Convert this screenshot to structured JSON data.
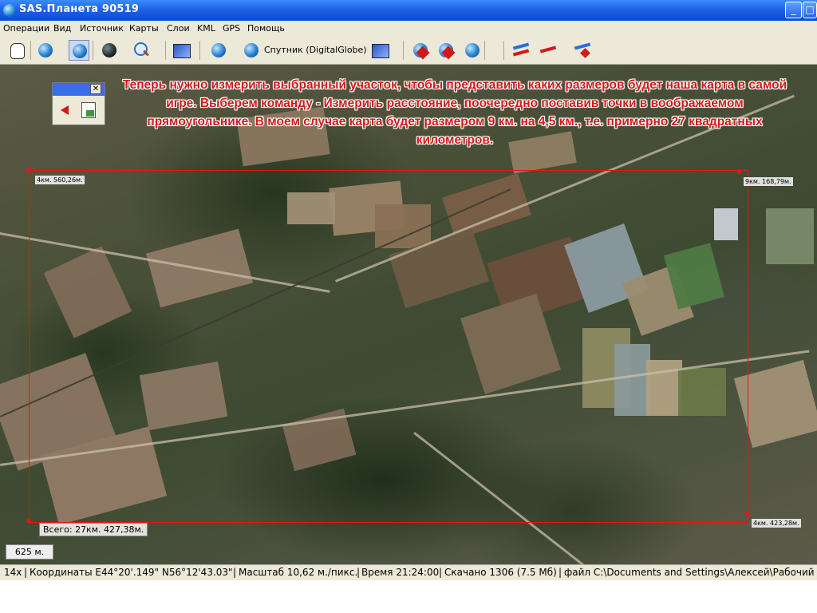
{
  "window": {
    "title": "SAS.Планета 90519",
    "minimize_glyph": "_",
    "maximize_glyph": "□"
  },
  "menu": [
    "Операции",
    "Вид",
    "Источник",
    "Карты",
    "Слои",
    "KML",
    "GPS",
    "Помощь"
  ],
  "toolbar": {
    "source_label": "Спутник (DigitalGlobe)",
    "icons": [
      "hand-icon",
      "settings-globe-icon",
      "globe-active-icon",
      "dark-globe-icon",
      "zoom-icon",
      "map-image-icon",
      "globe-blue-icon",
      "satellite-source-icon",
      "layers-icon",
      "marker-icon",
      "delete-marker-icon",
      "refresh-icon",
      "line-measure-icon",
      "polygon-icon",
      "delete-path-icon"
    ]
  },
  "mini_panel": {
    "close_glyph": "✕"
  },
  "overlay_text": "Теперь нужно измерить выбранный участок, чтобы представить каких размеров будет наша карта в самой игре. Выберем команду - Измерить расстояние, поочередно поставив точки в воображаемом прямоугольнике. В моем случае карта будет размером 9 км. на 4,5 км., т.е. примерно 27 квадратных километров.",
  "measure": {
    "top_left": "4км. 560,26м.",
    "top_right": "9км. 168,79м.",
    "bottom_right": "4км. 423,28м.",
    "total": "Всего: 27км. 427,38м."
  },
  "scale": "625 м.",
  "status": {
    "zoom": "14x",
    "coordinates": "Координаты E44°20'.149\" N56°12'43.03\"",
    "scale": "Масштаб 10,62 м./пикс.",
    "time": "Время 21:24:00",
    "downloaded": "Скачано 1306 (7.5 Мб)",
    "file": "файл C:\\Documents and Settings\\Алексей\\Рабочий"
  }
}
